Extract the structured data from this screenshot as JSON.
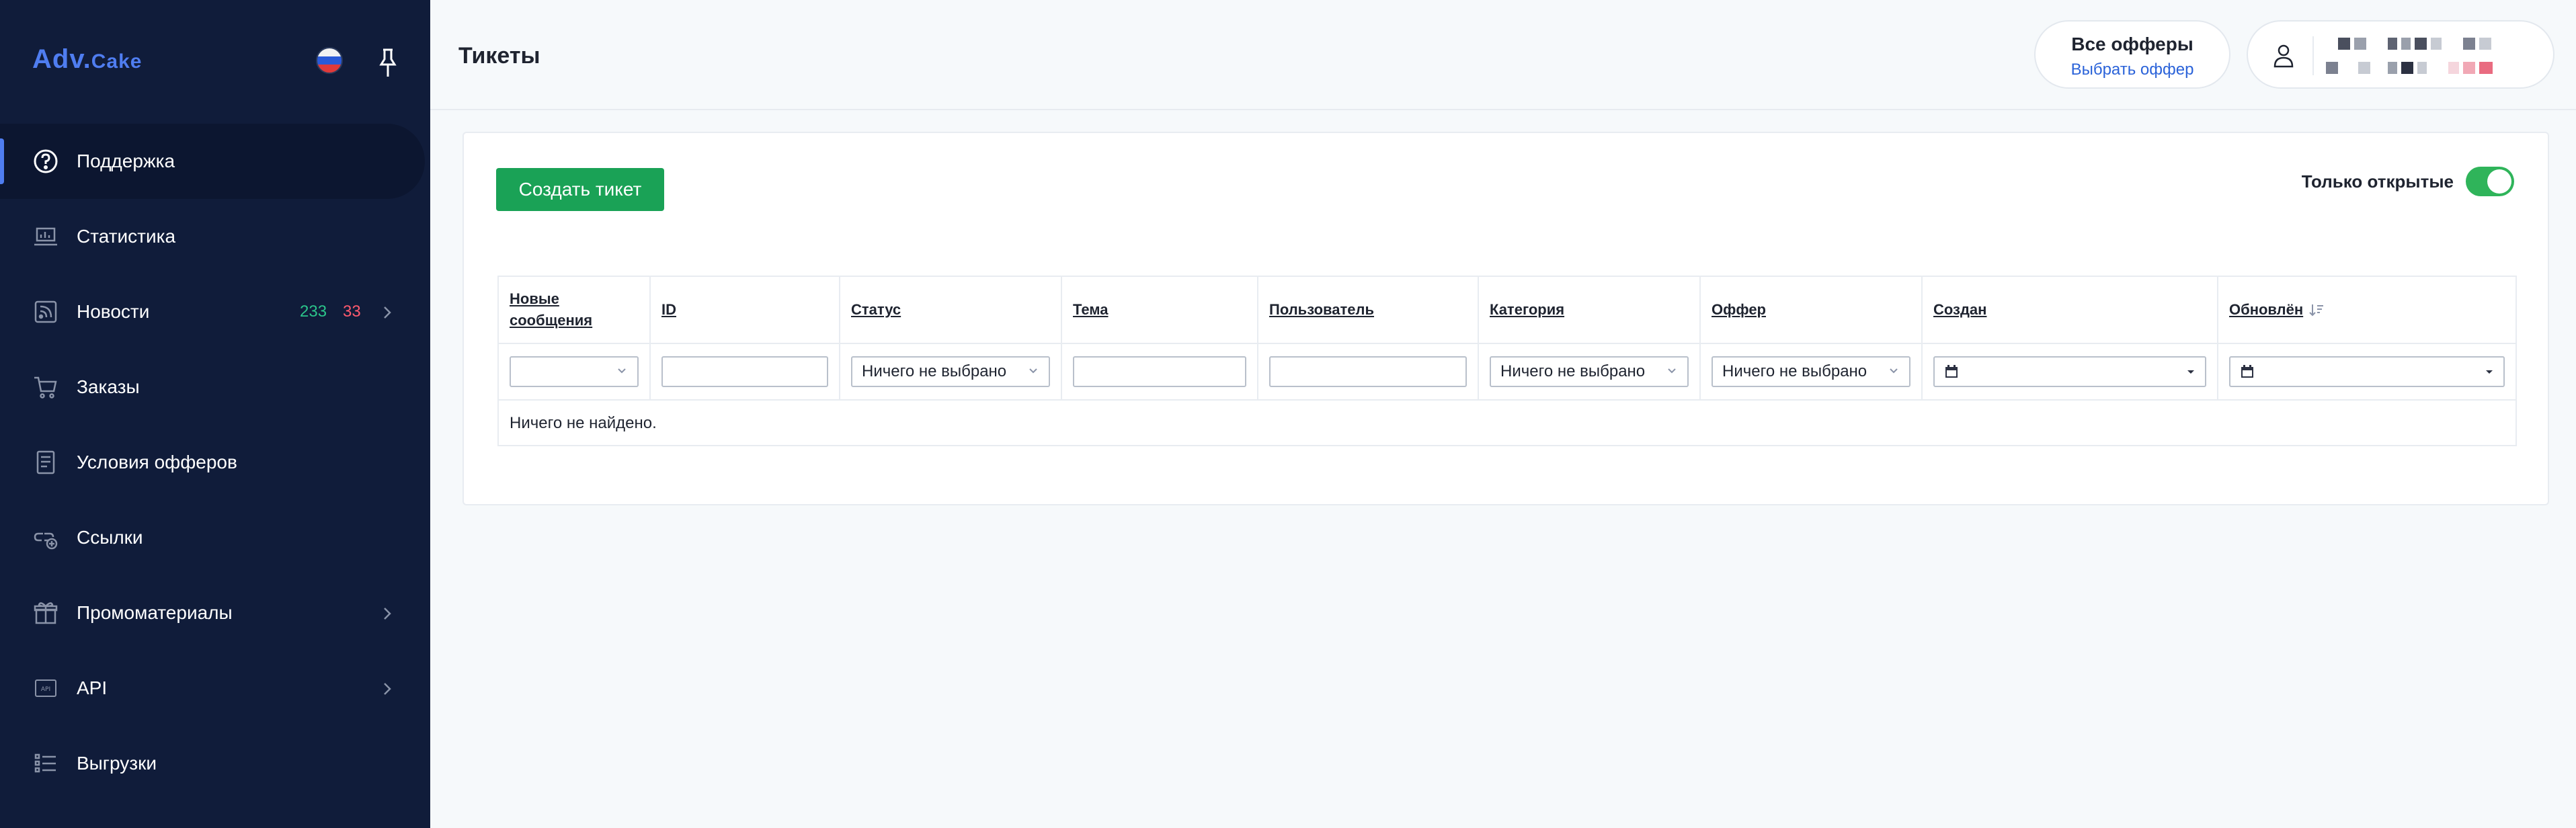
{
  "app": {
    "logo_main": "Adv",
    "logo_dot": ".",
    "logo_second": "Cake"
  },
  "sidebar": {
    "items": [
      {
        "label": "Поддержка",
        "icon": "question-circle-icon",
        "active": true
      },
      {
        "label": "Статистика",
        "icon": "laptop-chart-icon"
      },
      {
        "label": "Новости",
        "icon": "rss-icon",
        "badge_green": "233",
        "badge_red": "33",
        "has_arrow": true
      },
      {
        "label": "Заказы",
        "icon": "cart-icon"
      },
      {
        "label": "Условия офферов",
        "icon": "document-list-icon"
      },
      {
        "label": "Ссылки",
        "icon": "link-add-icon"
      },
      {
        "label": "Промоматериалы",
        "icon": "gift-icon",
        "has_arrow": true
      },
      {
        "label": "API",
        "icon": "api-icon",
        "has_arrow": true
      },
      {
        "label": "Выгрузки",
        "icon": "list-icon"
      }
    ]
  },
  "header": {
    "title": "Тикеты",
    "offers_title": "Все офферы",
    "offers_link": "Выбрать оффер"
  },
  "main": {
    "create_button": "Создать тикет",
    "only_open_label": "Только открытые",
    "only_open_on": true,
    "columns": [
      {
        "label": "Новые сообщения"
      },
      {
        "label": "ID"
      },
      {
        "label": "Статус"
      },
      {
        "label": "Тема"
      },
      {
        "label": "Пользователь"
      },
      {
        "label": "Категория"
      },
      {
        "label": "Оффер"
      },
      {
        "label": "Создан"
      },
      {
        "label": "Обновлён"
      }
    ],
    "filters": {
      "new_messages": "",
      "status": "Ничего не выбрано",
      "category": "Ничего не выбрано",
      "offer": "Ничего не выбрано"
    },
    "empty_text": "Ничего не найдено."
  },
  "colors": {
    "sidebar_bg": "#101c3a",
    "accent": "#4f7df0",
    "create_button": "#1aa256",
    "toggle_on": "#2fb45a",
    "badge_green": "#2bc48a",
    "badge_red": "#ff5a6e"
  }
}
